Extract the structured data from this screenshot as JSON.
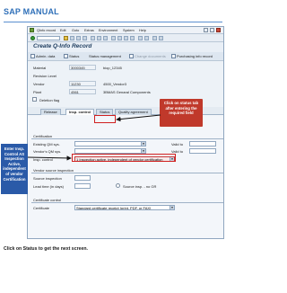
{
  "document": {
    "title": "SAP MANUAL",
    "instruction": "Click on Status to get the next screen."
  },
  "menubar": {
    "items": [
      "QInfo record",
      "Edit",
      "Goto",
      "Extras",
      "Environment",
      "System",
      "Help"
    ]
  },
  "screen": {
    "title": "Create Q-Info Record"
  },
  "app_toolbar": {
    "items": [
      {
        "label": "Admin. data",
        "enabled": true
      },
      {
        "label": "Status",
        "enabled": true
      },
      {
        "label": "Status management",
        "enabled": true
      },
      {
        "label": "Change documents",
        "enabled": false
      },
      {
        "label": "Purchasing info record",
        "enabled": true
      }
    ]
  },
  "header": {
    "material": {
      "label": "Material",
      "value": "3000345",
      "text": "biop_12345"
    },
    "revision_level": {
      "label": "Revision Level"
    },
    "vendor": {
      "label": "Vendor",
      "value": "11230",
      "text": "4500_Vendor3"
    },
    "plant": {
      "label": "Plant",
      "value": "4561",
      "text": "3BMAS Genaral Components"
    },
    "deletion_flag": {
      "label": "Deletion flag"
    }
  },
  "tabs": [
    {
      "label": "Release",
      "active": false
    },
    {
      "label": "Insp. control",
      "active": true
    },
    {
      "label": "Status",
      "active": false
    },
    {
      "label": "Quality agreement",
      "active": false
    }
  ],
  "certification": {
    "group_title": "Certification",
    "existing_qm_sys": {
      "label": "Existing QM sys.",
      "valid_to_label": "Valid to"
    },
    "vendors_qm_sys": {
      "label": "Vendor's QM sys.",
      "valid_to_label": "Valid to"
    },
    "insp_control": {
      "label": "Insp. control",
      "value": "1 Inspection active, independent of vendor certification"
    }
  },
  "source_inspection": {
    "group_title": "Vendor source inspection",
    "source_inspection_label": "Source inspection",
    "lead_time_label": "Lead time (in days)",
    "source_insp_no_gr_label": "Source insp. - no GR"
  },
  "certificate_control": {
    "group_title": "Certificate control",
    "certificate_label": "Certificate",
    "certificate_value": "Standard certificate receipt (print, PDF, or FAX)"
  },
  "callouts": {
    "right": "Click on status tab after entering the required field",
    "left": "Enter Insp. Control AS Inspection Active, independent of vendor Certification"
  },
  "colors": {
    "title_blue": "#2e6fb8",
    "callout_red": "#c0392b",
    "callout_blue": "#2a5aa8",
    "highlight_red": "#d02020"
  }
}
